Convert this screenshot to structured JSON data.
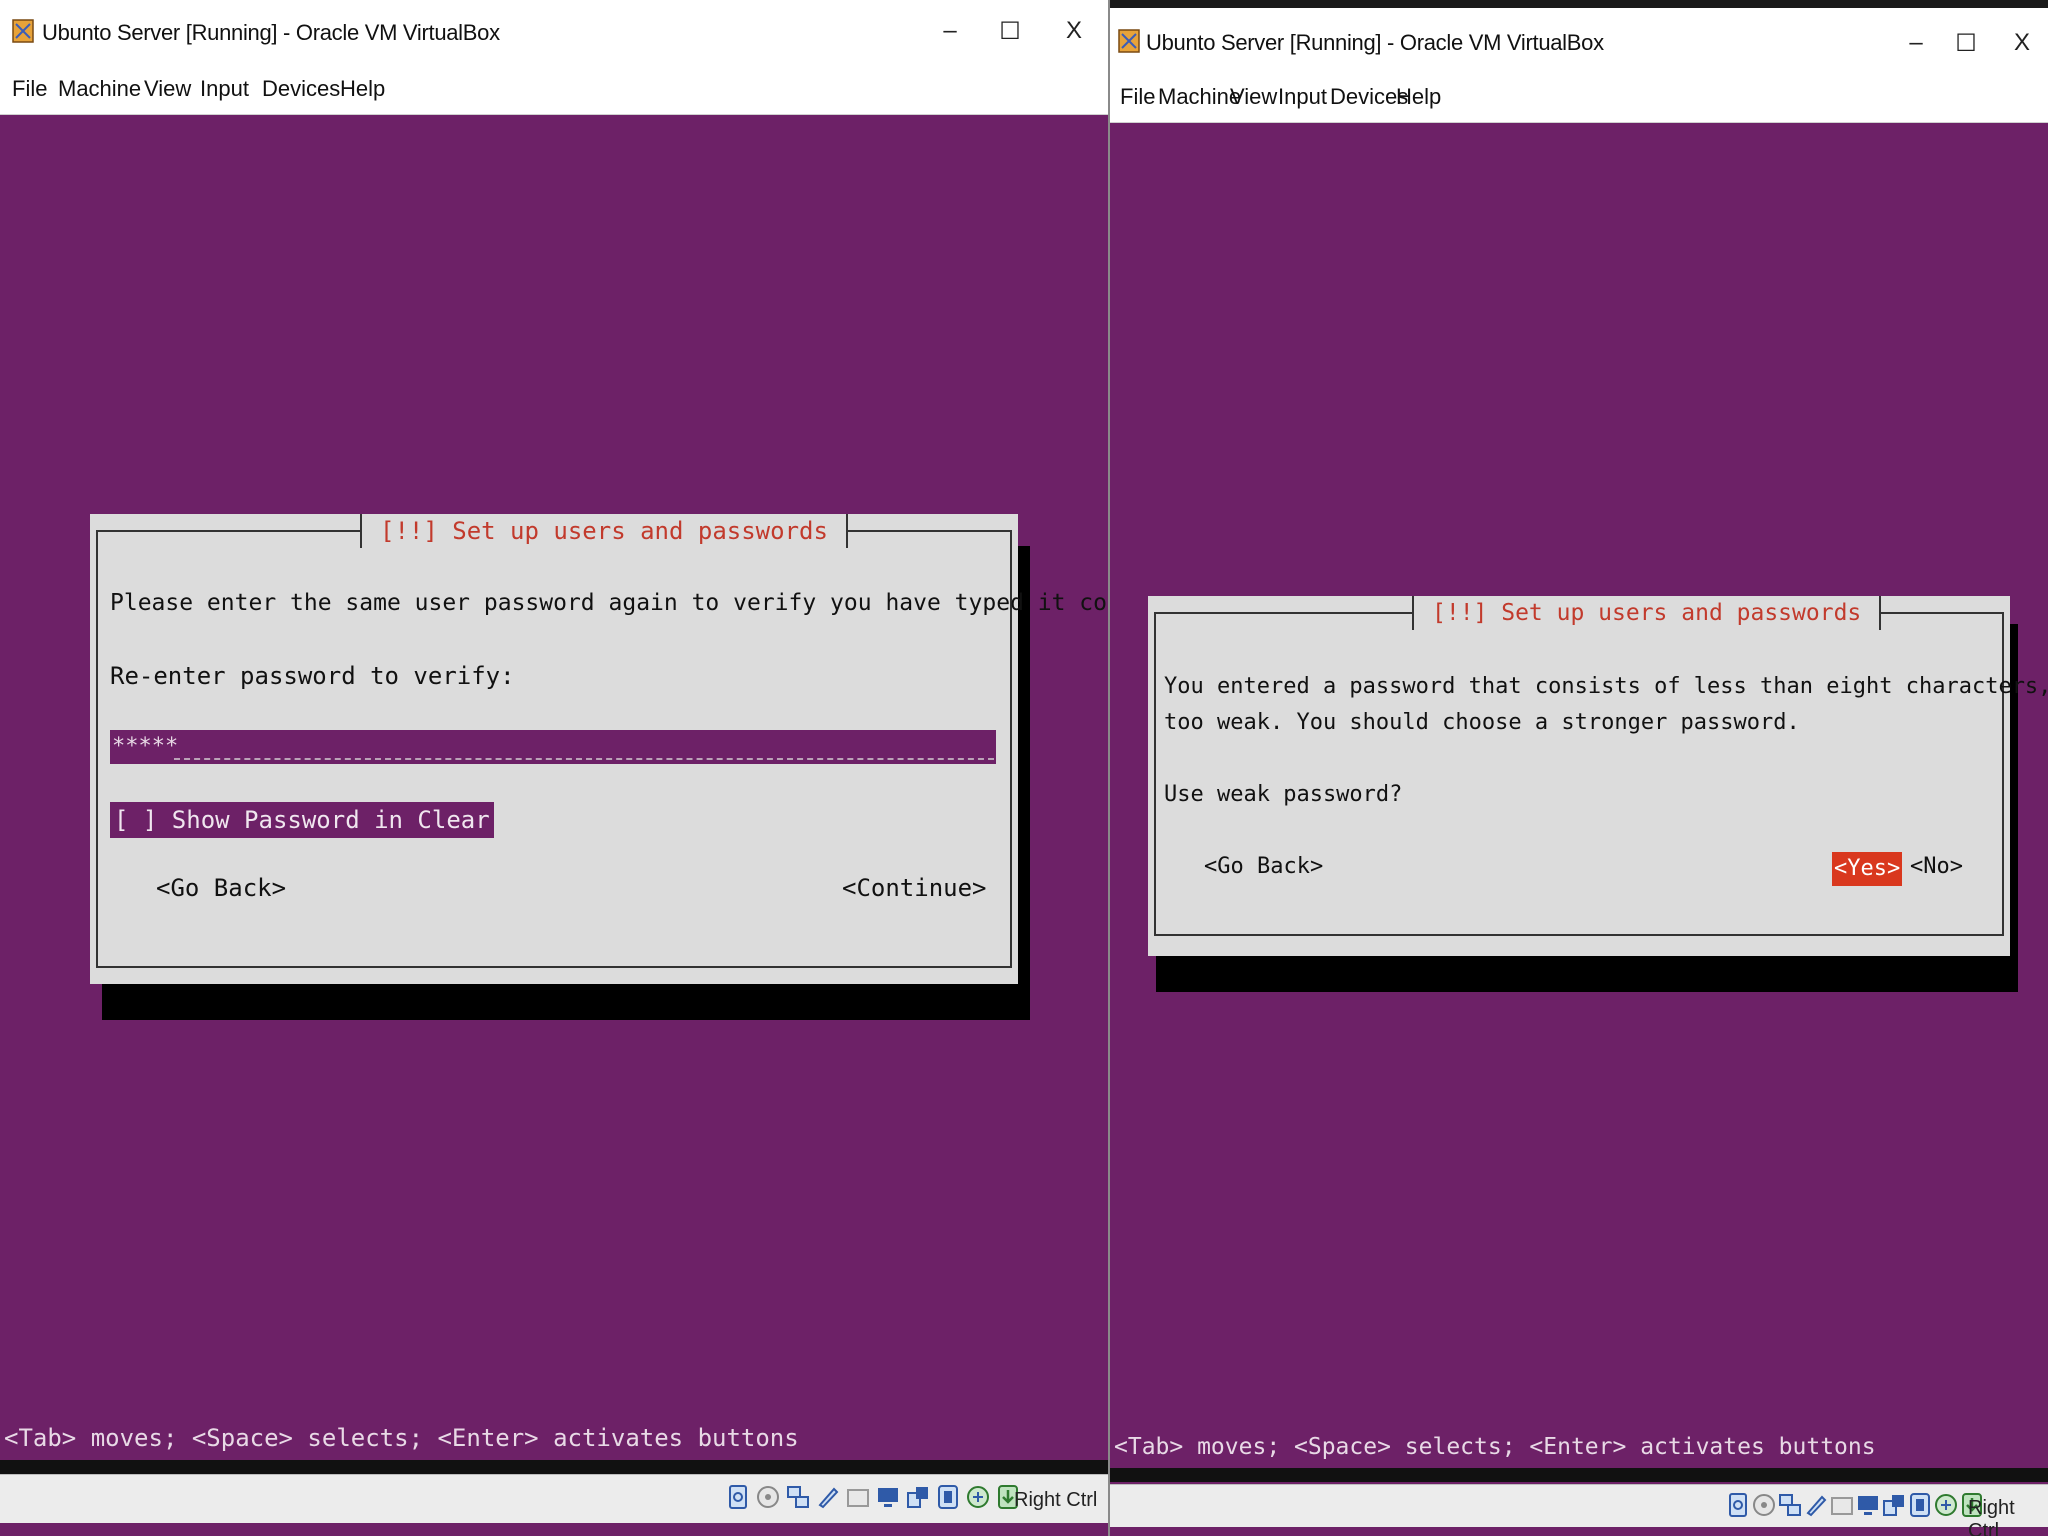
{
  "left": {
    "title": "Ubunto Server [Running] - Oracle VM VirtualBox",
    "menu": [
      "File",
      "Machine",
      "View",
      "Input",
      "Devices",
      "Help"
    ],
    "controls": {
      "minimize": "–",
      "maximize": "☐",
      "close": "X"
    },
    "dialog": {
      "title": "[!!] Set up users and passwords",
      "message": "Please enter the same user password again to verify you have typed it correctly.",
      "prompt": "Re-enter password to verify:",
      "password_mask": "*****",
      "checkbox_label": "[ ] Show Password in Clear",
      "go_back": "<Go Back>",
      "continue": "<Continue>"
    },
    "hint": "<Tab> moves; <Space> selects; <Enter> activates buttons",
    "host_key": "Right Ctrl"
  },
  "right": {
    "title": "Ubunto Server [Running] - Oracle VM VirtualBox",
    "menu": [
      "File",
      "Machine",
      "View",
      "Input",
      "Devices",
      "Help"
    ],
    "controls": {
      "minimize": "–",
      "maximize": "☐",
      "close": "X"
    },
    "dialog": {
      "title": "[!!] Set up users and passwords",
      "message_line1": "You entered a password that consists of less than eight characters, which is considered",
      "message_line2": "too weak. You should choose a stronger password.",
      "question": "Use weak password?",
      "go_back": "<Go Back>",
      "yes": "<Yes>",
      "no": "<No>",
      "selected_button": "yes"
    },
    "hint": "<Tab> moves; <Space> selects; <Enter> activates buttons",
    "host_key": "Right Ctrl"
  },
  "colors": {
    "terminal_bg": "#6d2167",
    "dialog_bg": "#dcdcdc",
    "title_red": "#c23a2c",
    "selected_button": "#d9381e"
  },
  "status_icons": [
    "hard-disk-icon",
    "optical-drive-icon",
    "network-icon",
    "usb-pen-icon",
    "shared-folder-icon",
    "display-icon",
    "screen-capture-icon",
    "recording-icon",
    "cpu-icon",
    "mouse-integration-icon"
  ]
}
